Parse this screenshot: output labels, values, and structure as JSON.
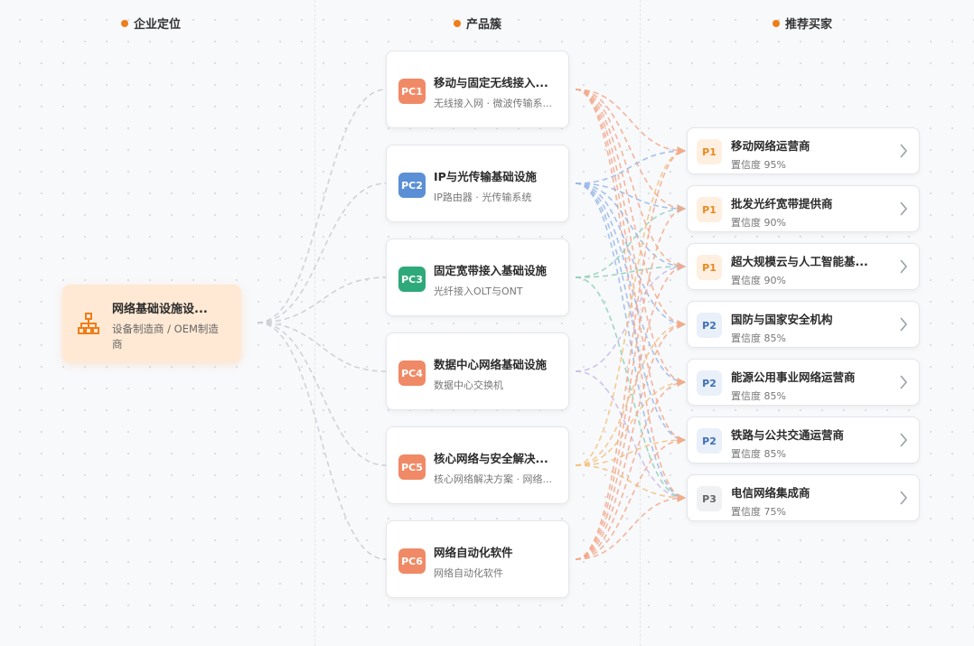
{
  "columns": {
    "company": "企业定位",
    "products": "产品簇",
    "buyers": "推荐买家"
  },
  "company": {
    "title": "网络基础设施设...",
    "subtitle": "设备制造商 / OEM制造商",
    "icon": "org-chart-icon",
    "color": "#ef7d1a"
  },
  "products": [
    {
      "code": "PC1",
      "title": "移动与固定无线接入...",
      "subtitle": "无线接入网 · 微波传输系...",
      "color": "#f08a66"
    },
    {
      "code": "PC2",
      "title": "IP与光传输基础设施",
      "subtitle": "IP路由器 · 光传输系统",
      "color": "#5b8fd6"
    },
    {
      "code": "PC3",
      "title": "固定宽带接入基础设施",
      "subtitle": "光纤接入OLT与ONT",
      "color": "#2eaa7a"
    },
    {
      "code": "PC4",
      "title": "数据中心网络基础设施",
      "subtitle": "数据中心交换机",
      "color": "#f08a66"
    },
    {
      "code": "PC5",
      "title": "核心网络与安全解决...",
      "subtitle": "核心网络解决方案 · 网络...",
      "color": "#f08a66"
    },
    {
      "code": "PC6",
      "title": "网络自动化软件",
      "subtitle": "网络自动化软件",
      "color": "#f08a66"
    }
  ],
  "buyers": [
    {
      "priority": "P1",
      "name": "移动网络运营商",
      "confidence": "置信度 95%"
    },
    {
      "priority": "P1",
      "name": "批发光纤宽带提供商",
      "confidence": "置信度 90%"
    },
    {
      "priority": "P1",
      "name": "超大规模云与人工智能基...",
      "confidence": "置信度 90%"
    },
    {
      "priority": "P2",
      "name": "国防与国家安全机构",
      "confidence": "置信度 85%"
    },
    {
      "priority": "P2",
      "name": "能源公用事业网络运营商",
      "confidence": "置信度 85%"
    },
    {
      "priority": "P2",
      "name": "铁路与公共交通运营商",
      "confidence": "置信度 85%"
    },
    {
      "priority": "P3",
      "name": "电信网络集成商",
      "confidence": "置信度 75%"
    }
  ],
  "priority_styles": {
    "P1": {
      "bg": "#ffefe0",
      "fg": "#e8891f"
    },
    "P2": {
      "bg": "#e9f0fa",
      "fg": "#3c6fb5"
    },
    "P3": {
      "bg": "#f0f1f3",
      "fg": "#666666"
    }
  },
  "links": [
    {
      "from": 0,
      "to": [
        0,
        1,
        2,
        3,
        4,
        5,
        6
      ]
    },
    {
      "from": 1,
      "to": [
        0,
        1,
        2,
        3,
        4,
        5,
        6
      ]
    },
    {
      "from": 2,
      "to": [
        1,
        2,
        6
      ]
    },
    {
      "from": 3,
      "to": [
        2,
        6
      ]
    },
    {
      "from": 4,
      "to": [
        0,
        3,
        4,
        5,
        6
      ]
    },
    {
      "from": 5,
      "to": [
        0,
        1,
        2,
        3,
        4,
        5,
        6
      ]
    }
  ]
}
